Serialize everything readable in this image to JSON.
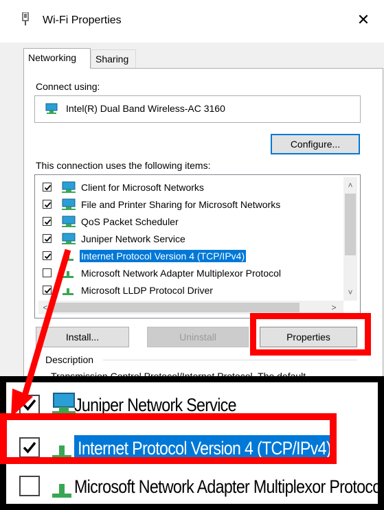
{
  "window": {
    "title": "Wi-Fi Properties",
    "close_glyph": "✕"
  },
  "tabs": [
    {
      "label": "Networking",
      "active": true
    },
    {
      "label": "Sharing",
      "active": false
    }
  ],
  "connect_using": {
    "label": "Connect using:",
    "adapter_name": "Intel(R) Dual Band Wireless-AC 3160",
    "icon": "network-adapter-icon",
    "configure_label": "Configure..."
  },
  "items_section": {
    "label": "This connection uses the following items:",
    "items": [
      {
        "label": "Client for Microsoft Networks",
        "checked": true,
        "icon": "network-client-icon",
        "selected": false
      },
      {
        "label": "File and Printer Sharing for Microsoft Networks",
        "checked": true,
        "icon": "network-service-icon",
        "selected": false
      },
      {
        "label": "QoS Packet Scheduler",
        "checked": true,
        "icon": "network-service-icon",
        "selected": false
      },
      {
        "label": "Juniper Network Service",
        "checked": true,
        "icon": "network-service-icon",
        "selected": false
      },
      {
        "label": "Internet Protocol Version 4 (TCP/IPv4)",
        "checked": true,
        "icon": "protocol-icon",
        "selected": true
      },
      {
        "label": "Microsoft Network Adapter Multiplexor Protocol",
        "checked": false,
        "icon": "protocol-icon",
        "selected": false
      },
      {
        "label": "Microsoft LLDP Protocol Driver",
        "checked": true,
        "icon": "protocol-icon",
        "selected": false
      }
    ]
  },
  "buttons": {
    "install": "Install...",
    "uninstall": "Uninstall",
    "properties": "Properties"
  },
  "description": {
    "label": "Description",
    "text": "Transmission Control Protocol/Internet Protocol. The default"
  },
  "zoom_inset": {
    "items": [
      {
        "label": "Juniper Network Service",
        "checked": true,
        "selected": false
      },
      {
        "label": "Internet Protocol Version 4 (TCP/IPv4)",
        "checked": true,
        "selected": true
      },
      {
        "label": "Microsoft Network Adapter Multiplexor Protocol",
        "checked": false,
        "selected": false
      }
    ]
  },
  "colors": {
    "highlight": "#ff0000",
    "selection": "#0078d7",
    "dialog_bg": "#f0f0f0"
  }
}
